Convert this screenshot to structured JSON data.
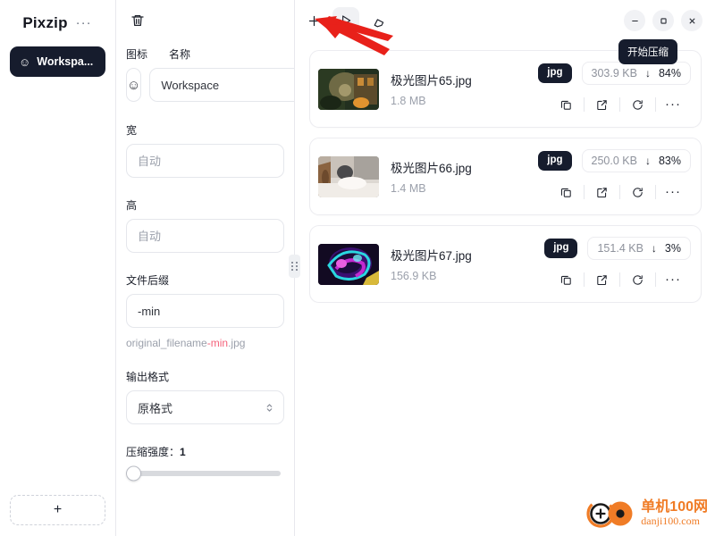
{
  "app": {
    "brand": "Pixzip",
    "more_menu": "···"
  },
  "sidebar": {
    "workspace_item": {
      "icon": "☺",
      "label": "Workspa..."
    },
    "add_workspace_label": "+"
  },
  "settings": {
    "delete_icon": "trash-icon",
    "labels": {
      "icon": "图标",
      "name": "名称",
      "width": "宽",
      "height": "高",
      "suffix": "文件后缀",
      "output_format": "输出格式",
      "strength": "压缩强度："
    },
    "icon_value": "☺",
    "name_value": "Workspace",
    "width_placeholder": "自动",
    "width_value": "",
    "height_placeholder": "自动",
    "height_value": "",
    "suffix_value": "-min",
    "preview": {
      "base": "original_filename",
      "suffix": "-min",
      "ext": ".jpg"
    },
    "output_format_value": "原格式",
    "strength_value": "1",
    "strength_percent": 0
  },
  "toolbar": {
    "add_label": "+",
    "play_label": "▷",
    "clear_label": "eraser-icon",
    "tooltip": "开始压缩"
  },
  "window_controls": {
    "minimize": "–",
    "maximize": "□",
    "close": "✕"
  },
  "files": [
    {
      "name": "极光图片65.jpg",
      "size": "1.8 MB",
      "format": "jpg",
      "out_size": "303.9 KB",
      "arrow": "↓",
      "percent": "84%",
      "thumb_colors": [
        "#1d2a1a",
        "#6d5a34",
        "#c8842f",
        "#2f3a2a"
      ]
    },
    {
      "name": "极光图片66.jpg",
      "size": "1.4 MB",
      "format": "jpg",
      "out_size": "250.0 KB",
      "arrow": "↓",
      "percent": "83%",
      "thumb_colors": [
        "#cfc9c4",
        "#8c6a4f",
        "#e7e3de",
        "#a09a94"
      ]
    },
    {
      "name": "极光图片67.jpg",
      "size": "156.9 KB",
      "format": "jpg",
      "out_size": "151.4 KB",
      "arrow": "↓",
      "percent": "3%",
      "thumb_colors": [
        "#120a22",
        "#2ad7e0",
        "#c22ad0",
        "#6a18a8"
      ]
    }
  ],
  "file_actions": {
    "copy": "copy-icon",
    "open": "open-external-icon",
    "redo": "refresh-icon",
    "more": "···"
  },
  "watermark": {
    "cn": "单机100网",
    "en": "danji100.com",
    "color": "#f07c26"
  },
  "colors": {
    "accent_dark": "#161c2d",
    "border": "#ececf0",
    "muted_text": "#9ba0ab",
    "suffix_highlight": "#f4627a",
    "annotation_red": "#e8211a"
  }
}
